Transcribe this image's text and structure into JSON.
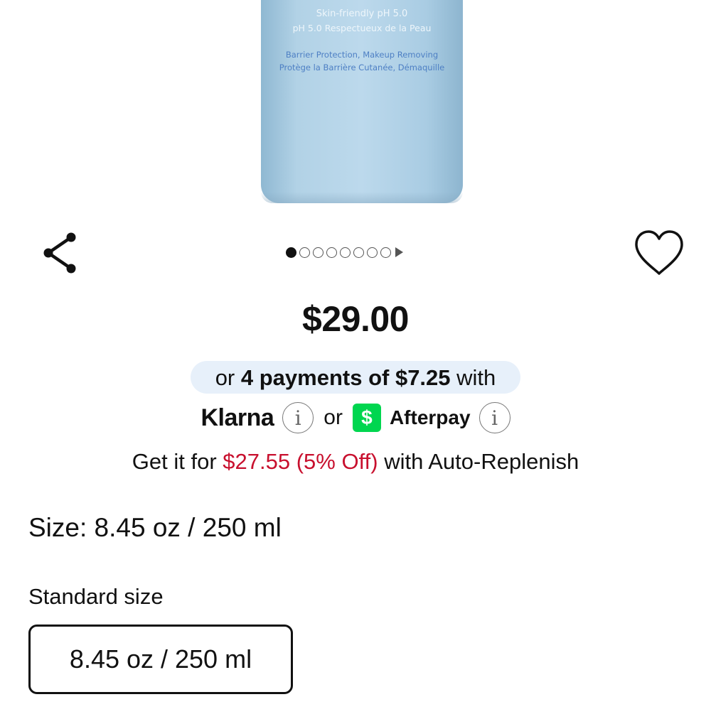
{
  "product_image": {
    "line1": "Skin-friendly pH 5.0",
    "line2": "pH 5.0 Respectueux de la Peau",
    "line3": "Barrier Protection, Makeup Removing",
    "line4": "Protège la Barrière Cutanée, Démaquille",
    "bottle_color": "#b2d2e6"
  },
  "actions": {
    "share_icon": "share-icon",
    "favorite_icon": "heart-outline-icon"
  },
  "carousel": {
    "total_dots": 8,
    "active_index": 0
  },
  "price": "$29.00",
  "installments": {
    "prefix": "or",
    "emphasis": "4 payments of $7.25",
    "suffix": "with",
    "klarna": "Klarna",
    "or": "or",
    "afterpay_symbol": "$",
    "afterpay": "Afterpay",
    "info_glyph": "i",
    "pill_color": "#e7f0fa"
  },
  "auto_replenish": {
    "prefix": "Get it for",
    "discount": "$27.55 (5% Off)",
    "suffix": "with Auto-Replenish",
    "discount_color": "#c8102e"
  },
  "size": {
    "label": "Size: 8.45 oz / 250 ml",
    "group_label": "Standard size",
    "options": [
      "8.45 oz / 250 ml"
    ]
  }
}
